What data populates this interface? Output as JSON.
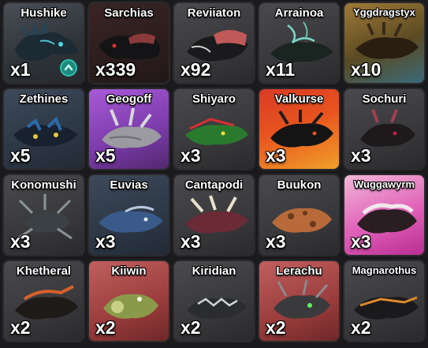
{
  "inventory": {
    "slots": [
      {
        "name": "Hushike",
        "count": "x1",
        "rarity_color": "#3a4046",
        "badge": "upgrade-arrow-icon"
      },
      {
        "name": "Sarchias",
        "count": "x339",
        "rarity_color": "#2a1c1c"
      },
      {
        "name": "Reviiaton",
        "count": "x92",
        "rarity_color": "#353538"
      },
      {
        "name": "Arrainoa",
        "count": "x11",
        "rarity_color": "#353538"
      },
      {
        "name": "Yggdragstyx",
        "count": "x10",
        "rarity_color": "#5a4a22"
      },
      {
        "name": "Zethines",
        "count": "x5",
        "rarity_color": "#2a2a2c"
      },
      {
        "name": "Geogoff",
        "count": "x5",
        "rarity_color": "#7a3aa8"
      },
      {
        "name": "Shiyaro",
        "count": "x3",
        "rarity_color": "#353538"
      },
      {
        "name": "Valkurse",
        "count": "x3",
        "rarity_color": "#e8541e"
      },
      {
        "name": "Sochuri",
        "count": "x3",
        "rarity_color": "#353538"
      },
      {
        "name": "Konomushi",
        "count": "x3",
        "rarity_color": "#353538"
      },
      {
        "name": "Euvias",
        "count": "x3",
        "rarity_color": "#2a3442"
      },
      {
        "name": "Cantapodi",
        "count": "x3",
        "rarity_color": "#353538"
      },
      {
        "name": "Buukon",
        "count": "x3",
        "rarity_color": "#353538"
      },
      {
        "name": "Wuggawyrm",
        "count": "x3",
        "rarity_color": "#e060b8"
      },
      {
        "name": "Khetheral",
        "count": "x2",
        "rarity_color": "#353538"
      },
      {
        "name": "Kiiwin",
        "count": "x2",
        "rarity_color": "#9a3c3c"
      },
      {
        "name": "Kiridian",
        "count": "x2",
        "rarity_color": "#353538"
      },
      {
        "name": "Lerachu",
        "count": "x2",
        "rarity_color": "#9a3c3c"
      },
      {
        "name": "Magnarothus",
        "count": "x2",
        "rarity_color": "#353538"
      }
    ]
  }
}
